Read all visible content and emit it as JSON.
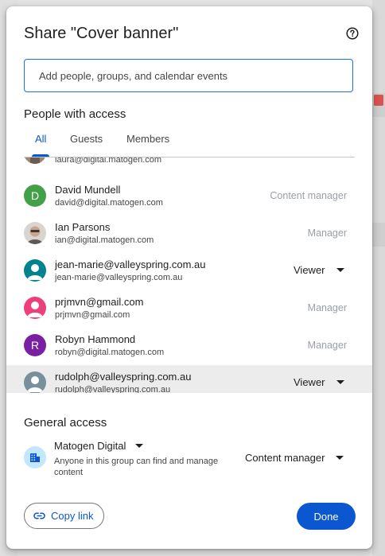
{
  "dialog": {
    "title": "Share \"Cover banner\"",
    "help_icon": "help-circle-icon",
    "add_input": {
      "placeholder": "Add people, groups, and calendar events"
    }
  },
  "people_with_access": {
    "heading": "People with access",
    "tabs": [
      {
        "label": "All",
        "active": true
      },
      {
        "label": "Guests",
        "active": false
      },
      {
        "label": "Members",
        "active": false
      }
    ],
    "partial_row": {
      "email": "laura@digital.matogen.com"
    },
    "people": [
      {
        "name": "David Mundell",
        "email": "david@digital.matogen.com",
        "role": "Content manager",
        "editable": false,
        "avatar_letter": "D",
        "avatar_color": "#43a047"
      },
      {
        "name": "Ian Parsons",
        "email": "ian@digital.matogen.com",
        "role": "Manager",
        "editable": false,
        "avatar_type": "photo"
      },
      {
        "name": "jean-marie@valleyspring.com.au",
        "email": "jean-marie@valleyspring.com.au",
        "role": "Viewer",
        "editable": true,
        "avatar_color": "#00838f"
      },
      {
        "name": "prjmvn@gmail.com",
        "email": "prjmvn@gmail.com",
        "role": "Manager",
        "editable": false,
        "avatar_color": "#ec407a"
      },
      {
        "name": "Robyn Hammond",
        "email": "robyn@digital.matogen.com",
        "role": "Manager",
        "editable": false,
        "avatar_letter": "R",
        "avatar_color": "#7b1fa2"
      },
      {
        "name": "rudolph@valleyspring.com.au",
        "email": "rudolph@valleyspring.com.au",
        "role": "Viewer",
        "editable": true,
        "avatar_color": "#78909c"
      }
    ]
  },
  "general_access": {
    "heading": "General access",
    "group_name": "Matogen Digital",
    "description": "Anyone in this group can find and manage content",
    "role": "Content manager",
    "icon": "domain-building-icon"
  },
  "footer": {
    "copy_link_label": "Copy link",
    "done_label": "Done"
  },
  "colors": {
    "accent": "#0b57d0",
    "highlight_row": "#ececec"
  }
}
